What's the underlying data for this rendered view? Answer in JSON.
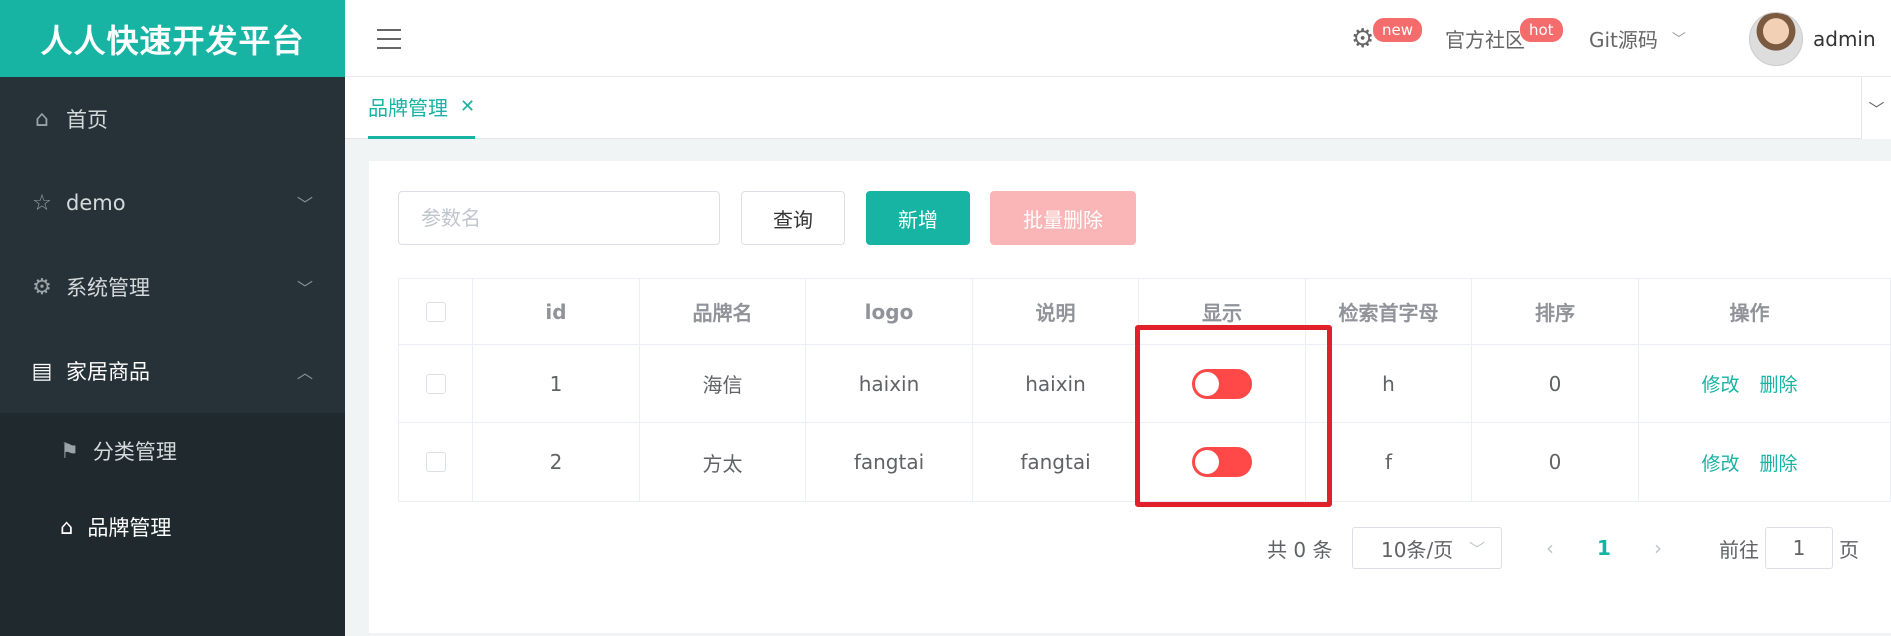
{
  "app": {
    "title": "人人快速开发平台"
  },
  "navbar": {
    "settings_badge": "new",
    "community_label": "官方社区",
    "community_badge": "hot",
    "git_label": "Git源码",
    "user_name": "admin"
  },
  "sidebar": {
    "items": [
      {
        "label": "首页",
        "icon": "home-icon"
      },
      {
        "label": "demo",
        "icon": "star-icon"
      },
      {
        "label": "系统管理",
        "icon": "gear-icon"
      },
      {
        "label": "家居商品",
        "icon": "document-icon"
      }
    ],
    "subitems": [
      {
        "label": "分类管理",
        "icon": "tag-icon"
      },
      {
        "label": "品牌管理",
        "icon": "home-icon"
      }
    ]
  },
  "tabs": [
    {
      "label": "品牌管理"
    }
  ],
  "toolbar": {
    "search_placeholder": "参数名",
    "query_label": "查询",
    "add_label": "新增",
    "batch_delete_label": "批量删除"
  },
  "table": {
    "headers": [
      "id",
      "品牌名",
      "logo",
      "说明",
      "显示",
      "检索首字母",
      "排序",
      "操作"
    ],
    "rows": [
      {
        "id": "1",
        "name": "海信",
        "logo": "haixin",
        "desc": "haixin",
        "show": false,
        "letter": "h",
        "sort": "0"
      },
      {
        "id": "2",
        "name": "方太",
        "logo": "fangtai",
        "desc": "fangtai",
        "show": false,
        "letter": "f",
        "sort": "0"
      }
    ],
    "edit_label": "修改",
    "delete_label": "删除"
  },
  "pagination": {
    "total_text": "共 0 条",
    "page_size": "10条/页",
    "current_page": "1",
    "goto_label": "前往",
    "goto_value": "1",
    "page_suffix": "页"
  },
  "colors": {
    "accent": "#17b3a3",
    "danger": "#ff4949",
    "highlight": "#e0202a"
  }
}
